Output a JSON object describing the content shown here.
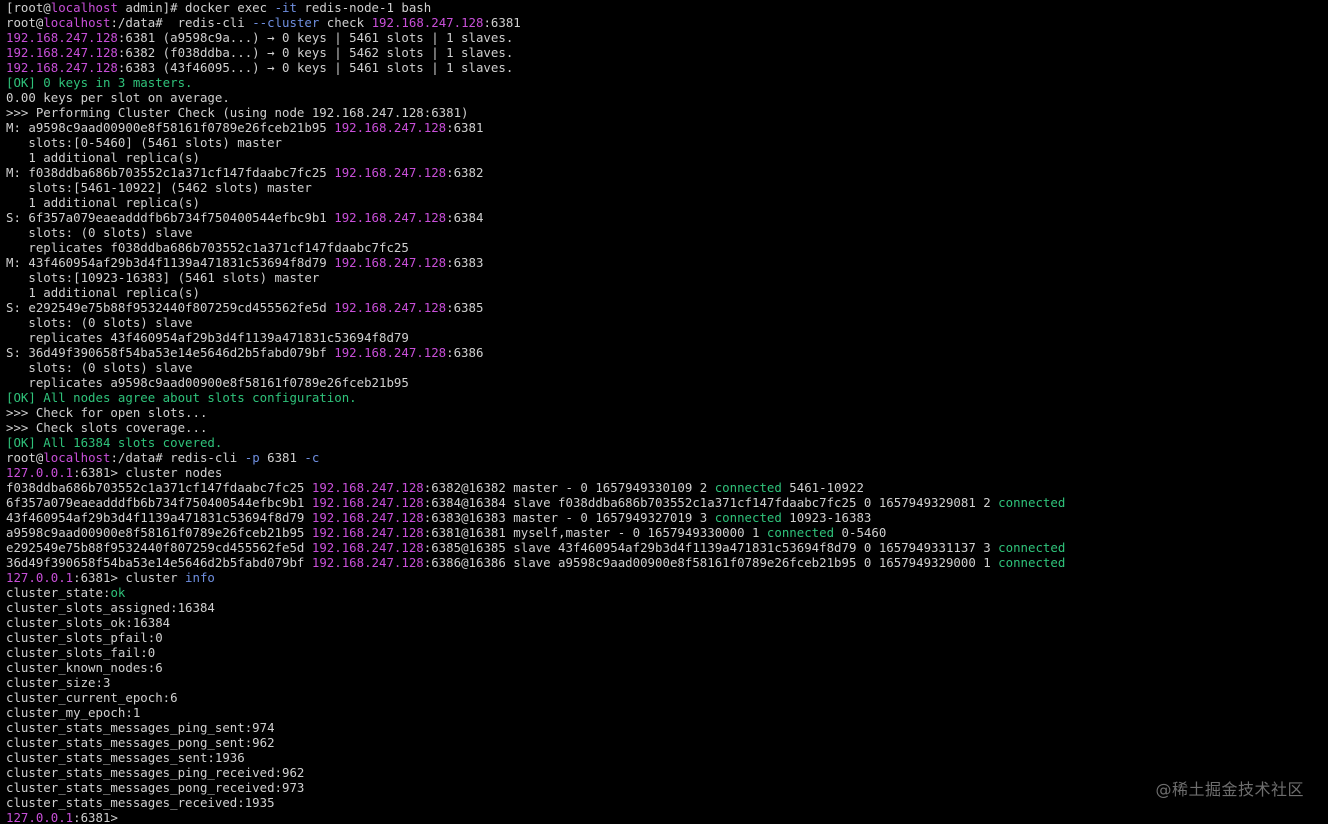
{
  "colors": {
    "default": "#d0d0d0",
    "magenta": "#c84fd8",
    "green": "#2fc27a",
    "blue": "#6f8fe0",
    "background": "#000000"
  },
  "watermark": "@稀土掘金技术社区",
  "lines": [
    [
      [
        "w",
        "[root@"
      ],
      [
        "m",
        "localhost"
      ],
      [
        "w",
        " admin]# docker exec "
      ],
      [
        "b",
        "-it"
      ],
      [
        "w",
        " redis-node-1 bash"
      ]
    ],
    [
      [
        "w",
        "root@"
      ],
      [
        "m",
        "localhost"
      ],
      [
        "w",
        ":/data#  redis-cli "
      ],
      [
        "b",
        "--cluster"
      ],
      [
        "w",
        " check "
      ],
      [
        "m",
        "192.168.247.128"
      ],
      [
        "w",
        ":6381"
      ]
    ],
    [
      [
        "m",
        "192.168.247.128"
      ],
      [
        "w",
        ":6381 (a9598c9a...) → 0 keys | 5461 slots | 1 slaves."
      ]
    ],
    [
      [
        "m",
        "192.168.247.128"
      ],
      [
        "w",
        ":6382 (f038ddba...) → 0 keys | 5462 slots | 1 slaves."
      ]
    ],
    [
      [
        "m",
        "192.168.247.128"
      ],
      [
        "w",
        ":6383 (43f46095...) → 0 keys | 5461 slots | 1 slaves."
      ]
    ],
    [
      [
        "g",
        "[OK] 0 keys in 3 masters."
      ]
    ],
    [
      [
        "w",
        "0.00 keys per slot on average."
      ]
    ],
    [
      [
        "w",
        ">>> Performing Cluster Check (using node 192.168.247.128:6381)"
      ]
    ],
    [
      [
        "w",
        "M: a9598c9aad00900e8f58161f0789e26fceb21b95 "
      ],
      [
        "m",
        "192.168.247.128"
      ],
      [
        "w",
        ":6381"
      ]
    ],
    [
      [
        "w",
        "   slots:[0-5460] (5461 slots) master"
      ]
    ],
    [
      [
        "w",
        "   1 additional replica(s)"
      ]
    ],
    [
      [
        "w",
        "M: f038ddba686b703552c1a371cf147fdaabc7fc25 "
      ],
      [
        "m",
        "192.168.247.128"
      ],
      [
        "w",
        ":6382"
      ]
    ],
    [
      [
        "w",
        "   slots:[5461-10922] (5462 slots) master"
      ]
    ],
    [
      [
        "w",
        "   1 additional replica(s)"
      ]
    ],
    [
      [
        "w",
        "S: 6f357a079eaeadddfb6b734f750400544efbc9b1 "
      ],
      [
        "m",
        "192.168.247.128"
      ],
      [
        "w",
        ":6384"
      ]
    ],
    [
      [
        "w",
        "   slots: (0 slots) slave"
      ]
    ],
    [
      [
        "w",
        "   replicates f038ddba686b703552c1a371cf147fdaabc7fc25"
      ]
    ],
    [
      [
        "w",
        "M: 43f460954af29b3d4f1139a471831c53694f8d79 "
      ],
      [
        "m",
        "192.168.247.128"
      ],
      [
        "w",
        ":6383"
      ]
    ],
    [
      [
        "w",
        "   slots:[10923-16383] (5461 slots) master"
      ]
    ],
    [
      [
        "w",
        "   1 additional replica(s)"
      ]
    ],
    [
      [
        "w",
        "S: e292549e75b88f9532440f807259cd455562fe5d "
      ],
      [
        "m",
        "192.168.247.128"
      ],
      [
        "w",
        ":6385"
      ]
    ],
    [
      [
        "w",
        "   slots: (0 slots) slave"
      ]
    ],
    [
      [
        "w",
        "   replicates 43f460954af29b3d4f1139a471831c53694f8d79"
      ]
    ],
    [
      [
        "w",
        "S: 36d49f390658f54ba53e14e5646d2b5fabd079bf "
      ],
      [
        "m",
        "192.168.247.128"
      ],
      [
        "w",
        ":6386"
      ]
    ],
    [
      [
        "w",
        "   slots: (0 slots) slave"
      ]
    ],
    [
      [
        "w",
        "   replicates a9598c9aad00900e8f58161f0789e26fceb21b95"
      ]
    ],
    [
      [
        "g",
        "[OK] All nodes agree about slots configuration."
      ]
    ],
    [
      [
        "w",
        ">>> Check for open slots..."
      ]
    ],
    [
      [
        "w",
        ">>> Check slots coverage..."
      ]
    ],
    [
      [
        "g",
        "[OK] All 16384 slots covered."
      ]
    ],
    [
      [
        "w",
        "root@"
      ],
      [
        "m",
        "localhost"
      ],
      [
        "w",
        ":/data# redis-cli "
      ],
      [
        "b",
        "-p"
      ],
      [
        "w",
        " 6381 "
      ],
      [
        "b",
        "-c"
      ]
    ],
    [
      [
        "m",
        "127.0.0.1"
      ],
      [
        "w",
        ":6381> cluster nodes"
      ]
    ],
    [
      [
        "w",
        "f038ddba686b703552c1a371cf147fdaabc7fc25 "
      ],
      [
        "m",
        "192.168.247.128"
      ],
      [
        "w",
        ":6382@16382 master - 0 1657949330109 2 "
      ],
      [
        "g",
        "connected"
      ],
      [
        "w",
        " 5461-10922"
      ]
    ],
    [
      [
        "w",
        "6f357a079eaeadddfb6b734f750400544efbc9b1 "
      ],
      [
        "m",
        "192.168.247.128"
      ],
      [
        "w",
        ":6384@16384 slave f038ddba686b703552c1a371cf147fdaabc7fc25 0 1657949329081 2 "
      ],
      [
        "g",
        "connected"
      ]
    ],
    [
      [
        "w",
        "43f460954af29b3d4f1139a471831c53694f8d79 "
      ],
      [
        "m",
        "192.168.247.128"
      ],
      [
        "w",
        ":6383@16383 master - 0 1657949327019 3 "
      ],
      [
        "g",
        "connected"
      ],
      [
        "w",
        " 10923-16383"
      ]
    ],
    [
      [
        "w",
        "a9598c9aad00900e8f58161f0789e26fceb21b95 "
      ],
      [
        "m",
        "192.168.247.128"
      ],
      [
        "w",
        ":6381@16381 myself,master - 0 1657949330000 1 "
      ],
      [
        "g",
        "connected"
      ],
      [
        "w",
        " 0-5460"
      ]
    ],
    [
      [
        "w",
        "e292549e75b88f9532440f807259cd455562fe5d "
      ],
      [
        "m",
        "192.168.247.128"
      ],
      [
        "w",
        ":6385@16385 slave 43f460954af29b3d4f1139a471831c53694f8d79 0 1657949331137 3 "
      ],
      [
        "g",
        "connected"
      ]
    ],
    [
      [
        "w",
        "36d49f390658f54ba53e14e5646d2b5fabd079bf "
      ],
      [
        "m",
        "192.168.247.128"
      ],
      [
        "w",
        ":6386@16386 slave a9598c9aad00900e8f58161f0789e26fceb21b95 0 1657949329000 1 "
      ],
      [
        "g",
        "connected"
      ]
    ],
    [
      [
        "m",
        "127.0.0.1"
      ],
      [
        "w",
        ":6381> cluster "
      ],
      [
        "b",
        "info"
      ]
    ],
    [
      [
        "w",
        "cluster_state:"
      ],
      [
        "g",
        "ok"
      ]
    ],
    [
      [
        "w",
        "cluster_slots_assigned:16384"
      ]
    ],
    [
      [
        "w",
        "cluster_slots_ok:16384"
      ]
    ],
    [
      [
        "w",
        "cluster_slots_pfail:0"
      ]
    ],
    [
      [
        "w",
        "cluster_slots_fail:0"
      ]
    ],
    [
      [
        "w",
        "cluster_known_nodes:6"
      ]
    ],
    [
      [
        "w",
        "cluster_size:3"
      ]
    ],
    [
      [
        "w",
        "cluster_current_epoch:6"
      ]
    ],
    [
      [
        "w",
        "cluster_my_epoch:1"
      ]
    ],
    [
      [
        "w",
        "cluster_stats_messages_ping_sent:974"
      ]
    ],
    [
      [
        "w",
        "cluster_stats_messages_pong_sent:962"
      ]
    ],
    [
      [
        "w",
        "cluster_stats_messages_sent:1936"
      ]
    ],
    [
      [
        "w",
        "cluster_stats_messages_ping_received:962"
      ]
    ],
    [
      [
        "w",
        "cluster_stats_messages_pong_received:973"
      ]
    ],
    [
      [
        "w",
        "cluster_stats_messages_received:1935"
      ]
    ],
    [
      [
        "m",
        "127.0.0.1"
      ],
      [
        "w",
        ":6381>"
      ]
    ]
  ]
}
